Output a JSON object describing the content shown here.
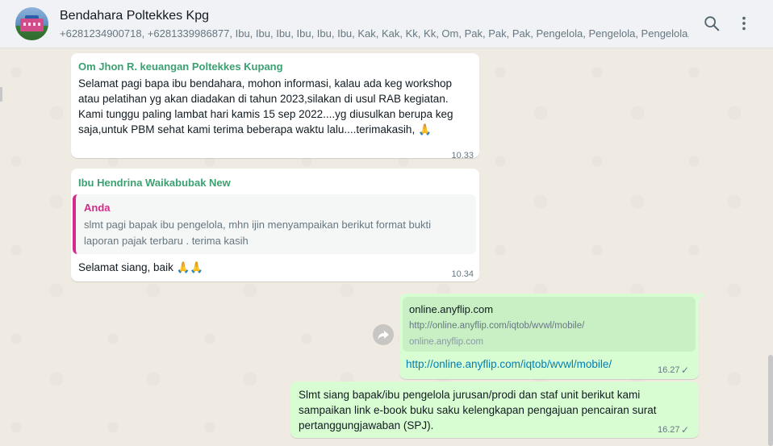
{
  "header": {
    "title": "Bendahara Poltekkes Kpg",
    "subtitle": "+6281234900718, +6281339986877, Ibu, Ibu, Ibu, Ibu, Ibu, Ibu, Kak, Kak, Kk, Kk, Om, Pak, Pak, Pak, Pengelola, Pengelola, Pengelola, P..."
  },
  "messages": {
    "m1": {
      "sender": "Om Jhon R. keuangan Poltekkes Kupang",
      "lines": [
        "Selamat pagi bapa ibu bendahara, mohon informasi, kalau ada keg workshop",
        "atau pelatihan yg akan diadakan di tahun 2023,silakan di usul RAB kegiatan.",
        "Kami tunggu paling lambat hari kamis 15 sep 2022....yg diusulkan berupa keg",
        "saja,untuk PBM sehat kami terima beberapa waktu lalu....terimakasih, 🙏"
      ],
      "time": "10.33"
    },
    "m2": {
      "sender": "Ibu Hendrina Waikabubak New",
      "quote_name": "Anda",
      "quote_lines": [
        "slmt pagi bapak ibu pengelola, mhn ijin menyampaikan berikut format bukti",
        "laporan pajak terbaru . terima kasih"
      ],
      "text": "Selamat siang, baik 🙏🙏",
      "time": "10.34"
    },
    "m3": {
      "preview_title": "online.anyflip.com",
      "preview_url": "http://online.anyflip.com/iqtob/wvwl/mobile/",
      "preview_domain": "online.anyflip.com",
      "link": "http://online.anyflip.com/iqtob/wvwl/mobile/",
      "time": "16.27",
      "status": "✓"
    },
    "m4": {
      "lines": [
        "Slmt siang bapak/ibu pengelola jurusan/prodi dan staf unit berikut kami",
        "sampaikan link e-book buku saku kelengkapan pengajuan pencairan surat",
        "pertanggungjawaban (SPJ)."
      ],
      "time": "16.27",
      "status": "✓"
    }
  },
  "icons": {
    "search": "search-icon",
    "menu": "more-options-icon",
    "forward": "forward-icon"
  },
  "colors": {
    "incoming_bubble": "#ffffff",
    "outgoing_bubble": "#d9fdd3",
    "sender_name": "#3ca170",
    "quote_accent": "#d42a8c",
    "link": "#027eb5"
  }
}
